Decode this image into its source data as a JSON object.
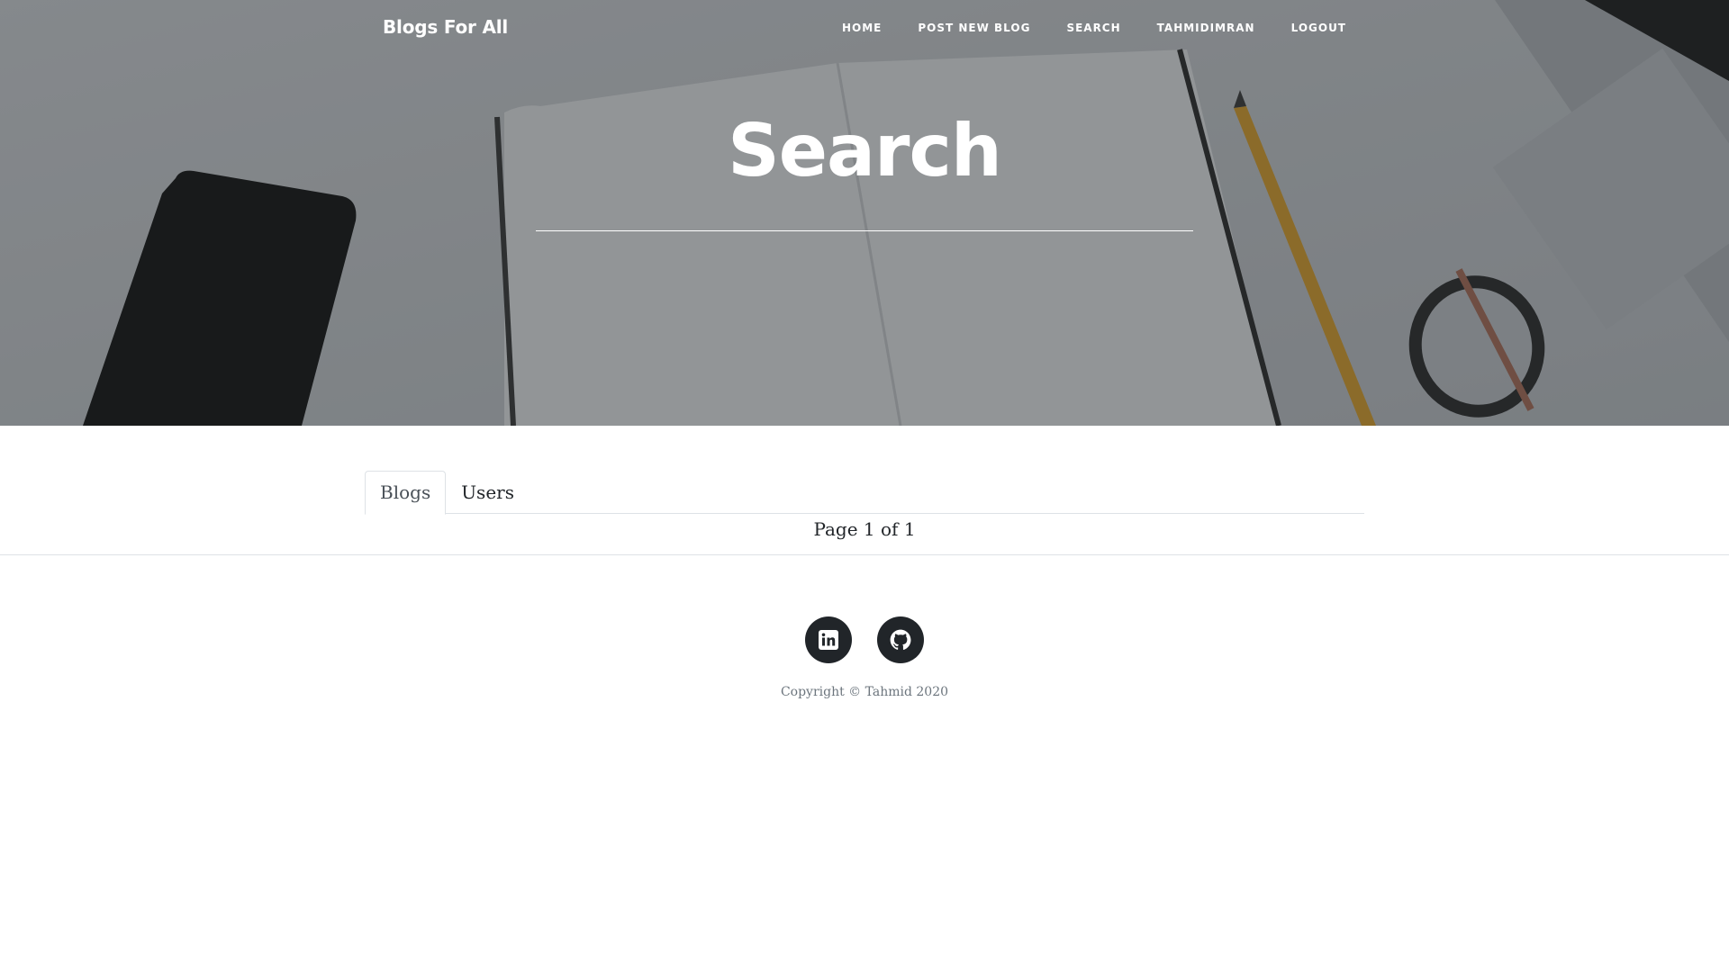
{
  "nav": {
    "brand": "Blogs For All",
    "links": [
      {
        "label": "Home"
      },
      {
        "label": "Post New Blog"
      },
      {
        "label": "Search"
      },
      {
        "label": "tahmidimran"
      },
      {
        "label": "Logout"
      }
    ]
  },
  "hero": {
    "title": "Search"
  },
  "tabs": {
    "items": [
      {
        "label": "Blogs",
        "active": true
      },
      {
        "label": "Users",
        "active": false
      }
    ]
  },
  "pagination": {
    "text": "Page 1 of 1"
  },
  "footer": {
    "social": [
      {
        "icon": "linkedin-icon"
      },
      {
        "icon": "github-icon"
      }
    ],
    "copyright": "Copyright © Tahmid 2020"
  },
  "colors": {
    "overlay": "#212529",
    "tab_border": "#dee2e6",
    "social_bg": "#212529",
    "muted_text": "#6c757d"
  }
}
